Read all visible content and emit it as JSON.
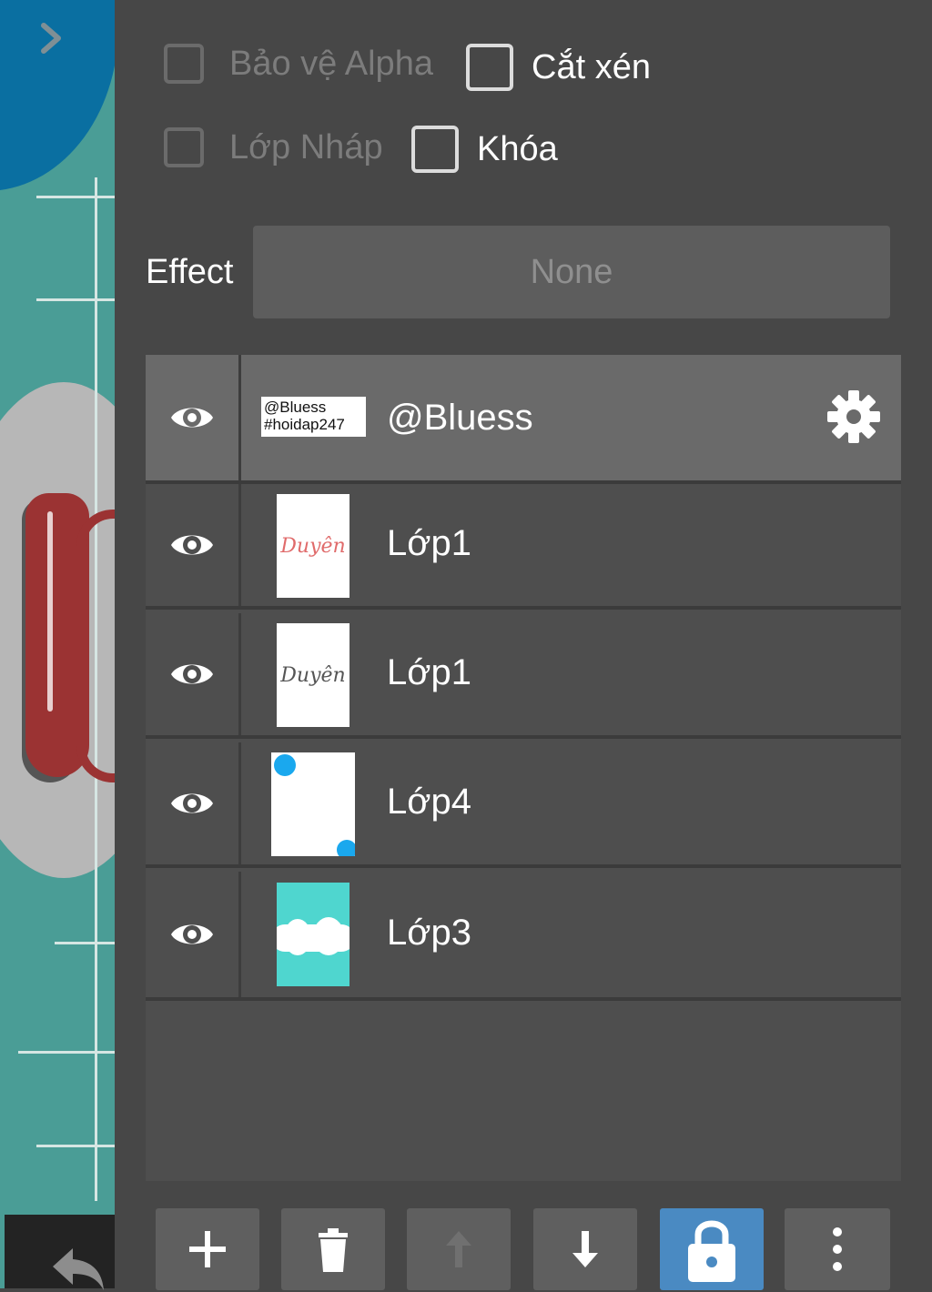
{
  "options": {
    "alpha_protect": {
      "label": "Bảo vệ Alpha",
      "checked": false,
      "enabled": false
    },
    "clipping": {
      "label": "Cắt xén",
      "checked": false,
      "enabled": true
    },
    "draft_layer": {
      "label": "Lớp Nháp",
      "checked": false,
      "enabled": false
    },
    "lock": {
      "label": "Khóa",
      "checked": false,
      "enabled": true
    }
  },
  "effect": {
    "label": "Effect",
    "value": "None"
  },
  "layers": [
    {
      "name": "@Bluess",
      "thumb_text_1": "@Bluess",
      "thumb_text_2": "#hoidap247",
      "visible": true,
      "selected": true,
      "settings_icon": "gear-icon"
    },
    {
      "name": "Lớp1",
      "thumb_text": "Duyên",
      "thumb_text_color": "#e06b6b",
      "visible": true
    },
    {
      "name": "Lớp1",
      "thumb_text": "Duyên",
      "thumb_text_color": "#555555",
      "visible": true
    },
    {
      "name": "Lớp4",
      "visible": true
    },
    {
      "name": "Lớp3",
      "visible": true
    }
  ],
  "toolbar": {
    "buttons": [
      {
        "icon": "plus-icon",
        "enabled": true
      },
      {
        "icon": "trash-icon",
        "enabled": true
      },
      {
        "icon": "arrow-up-icon",
        "enabled": false
      },
      {
        "icon": "arrow-down-icon",
        "enabled": true
      },
      {
        "icon": "lock-icon",
        "enabled": true,
        "active": true
      },
      {
        "icon": "more-vertical-icon",
        "enabled": true
      }
    ]
  },
  "colors": {
    "panel_bg": "#474747",
    "active_button": "#4a8ac2",
    "selected_layer": "#6a6a6a",
    "canvas_teal": "#4a9d96",
    "canvas_blue": "#0a6fa1"
  }
}
